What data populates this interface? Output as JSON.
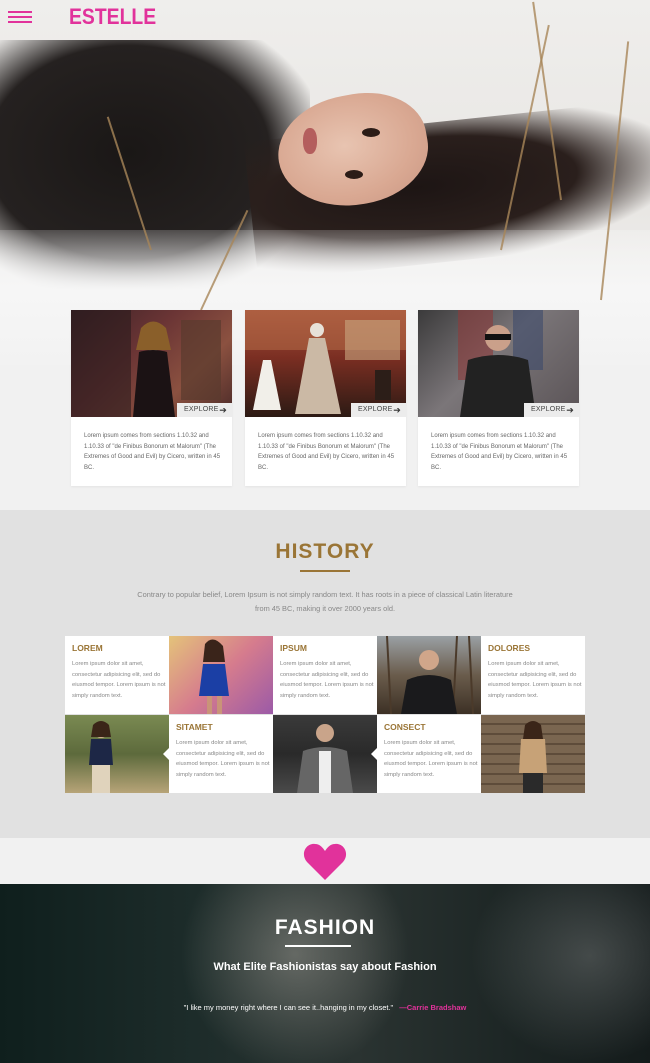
{
  "brand": {
    "logo": "ESTELLE",
    "accent": "#e1329b",
    "gold": "#9a7536"
  },
  "cards": [
    {
      "explore_label": "EXPLORE",
      "text": "Lorem ipsum comes from sections 1.10.32 and 1.10.33 of \"de Finibus Bonorum et Malorum\" (The Extremes of Good and Evil) by Cicero, written in 45 BC."
    },
    {
      "explore_label": "EXPLORE",
      "text": "Lorem ipsum comes from sections 1.10.32 and 1.10.33 of \"de Finibus Bonorum et Malorum\" (The Extremes of Good and Evil) by Cicero, written in 45 BC."
    },
    {
      "explore_label": "EXPLORE",
      "text": "Lorem ipsum comes from sections 1.10.32 and 1.10.33 of \"de Finibus Bonorum et Malorum\" (The Extremes of Good and Evil) by Cicero, written in 45 BC."
    }
  ],
  "history": {
    "title": "HISTORY",
    "description": "Contrary to popular belief, Lorem Ipsum is not simply random text. It has roots in a piece of classical Latin literature from 45 BC, making it over 2000 years old.",
    "items": [
      {
        "title": "LOREM",
        "body": "Lorem ipsum dolor sit amet, consectetur adipisicing elit, sed do eiusmod tempor. Lorem ipsum is not simply random text."
      },
      {
        "title": "IPSUM",
        "body": "Lorem ipsum dolor sit amet, consectetur adipisicing elit, sed do eiusmod tempor. Lorem ipsum is not simply random text."
      },
      {
        "title": "DOLORES",
        "body": "Lorem ipsum dolor sit amet, consectetur adipisicing elit, sed do eiusmod tempor. Lorem ipsum is not simply random text."
      },
      {
        "title": "SITAMET",
        "body": "Lorem ipsum dolor sit amet, consectetur adipisicing elit, sed do eiusmod tempor. Lorem ipsum is not simply random text."
      },
      {
        "title": "CONSECT",
        "body": "Lorem ipsum dolor sit amet, consectetur adipisicing elit, sed do eiusmod tempor. Lorem ipsum is not simply random text."
      }
    ]
  },
  "fashion": {
    "title": "FASHION",
    "subtitle": "What Elite Fashionistas say about Fashion",
    "quote": "\"I like my money right where I can see it..hanging in my closet.\"",
    "author": "—Carrie Bradshaw"
  }
}
